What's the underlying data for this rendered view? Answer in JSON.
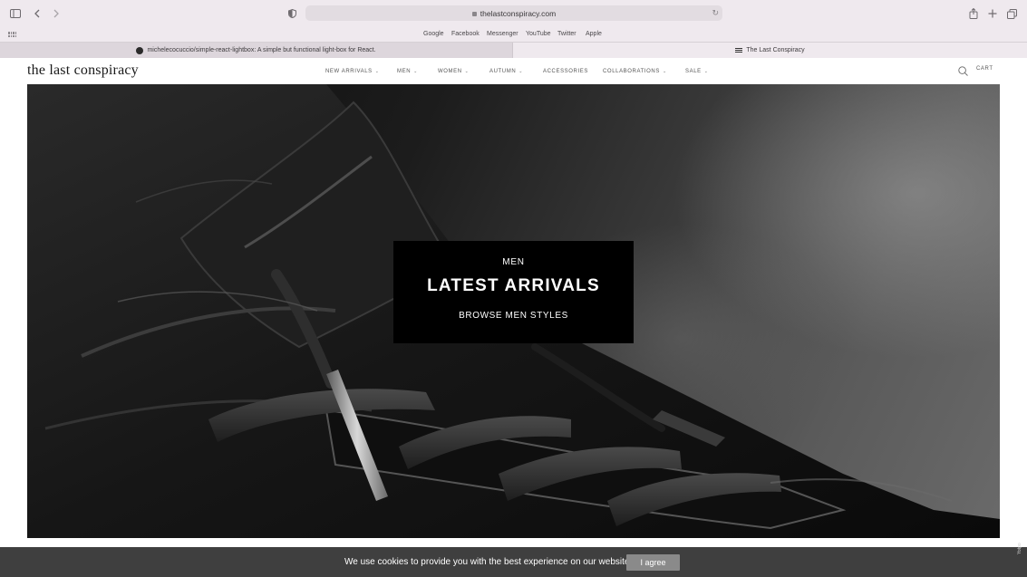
{
  "browser": {
    "url": "thelastconspiracy.com",
    "favorites": [
      "Google",
      "Facebook",
      "Messenger",
      "YouTube",
      "Twitter",
      "Apple"
    ],
    "tabs": [
      {
        "title": "michelecocuccio/simple-react-lightbox: A simple but functional light-box for React.",
        "icon": "github-icon",
        "active": false
      },
      {
        "title": "The Last Conspiracy",
        "icon": "site-favicon",
        "active": true
      }
    ],
    "icons": {
      "sidebar": "sidebar-icon",
      "back": "chevron-left-icon",
      "forward": "chevron-right-icon",
      "shield": "privacy-shield-icon",
      "reload": "reload-icon",
      "share": "share-icon",
      "new_tab": "plus-icon",
      "tabs_overview": "tabs-overview-icon"
    }
  },
  "site": {
    "logo": "the last conspiracy",
    "nav": [
      {
        "label": "NEW ARRIVALS",
        "has_dropdown": true
      },
      {
        "label": "MEN",
        "has_dropdown": true
      },
      {
        "label": "WOMEN",
        "has_dropdown": true
      },
      {
        "label": "AUTUMN",
        "has_dropdown": true
      },
      {
        "label": "ACCESSORIES",
        "has_dropdown": false
      },
      {
        "label": "COLLABORATIONS",
        "has_dropdown": true
      },
      {
        "label": "SALE",
        "has_dropdown": true
      }
    ],
    "cart_label": "CART"
  },
  "hero": {
    "kicker": "MEN",
    "title": "LATEST ARRIVALS",
    "link": "BROWSE MEN STYLES"
  },
  "cookie": {
    "text": "We use cookies to provide you with the best experience on our website",
    "button": "I agree"
  },
  "yotpo": "Yotpo",
  "colors": {
    "chrome": "#efe9ee",
    "cookie_bar": "#3f3f3f",
    "cookie_button": "#8a8a8a",
    "cta_box": "#000000"
  }
}
